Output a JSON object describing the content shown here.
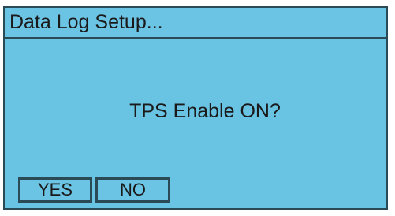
{
  "dialog": {
    "title": "Data Log Setup...",
    "prompt": "TPS Enable ON?",
    "buttons": {
      "yes_label": "YES",
      "no_label": "NO"
    }
  },
  "colors": {
    "screen_background": "#69c3e3",
    "border": "#2a4a56",
    "text": "#1a1a1a"
  }
}
